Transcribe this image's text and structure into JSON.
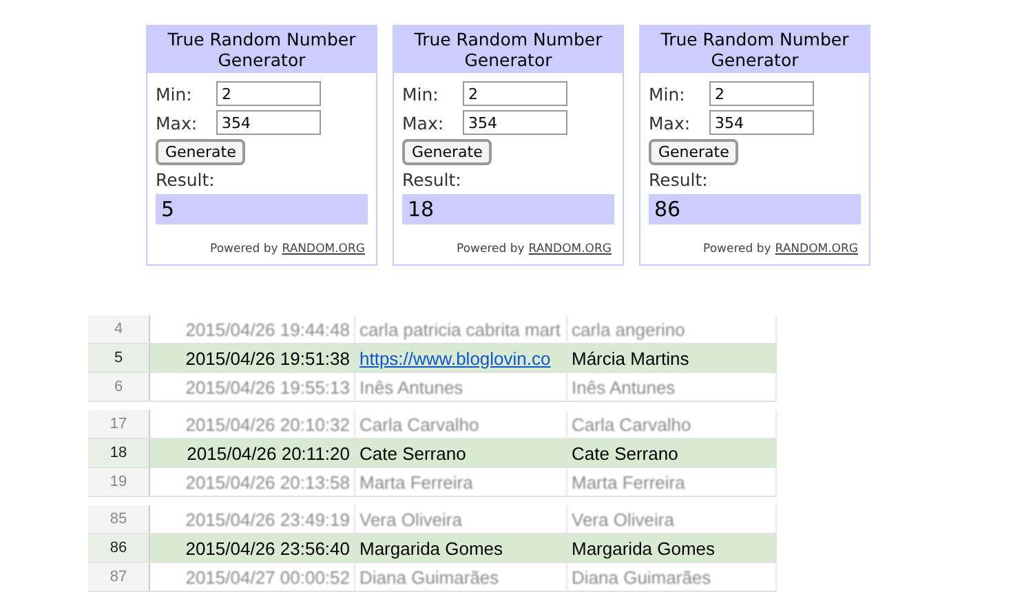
{
  "widgets": [
    {
      "title": "True Random Number Generator",
      "min_label": "Min:",
      "min": "2",
      "max_label": "Max:",
      "max": "354",
      "button": "Generate",
      "result_label": "Result:",
      "result": "5",
      "powered": "Powered by",
      "link": "RANDOM.ORG"
    },
    {
      "title": "True Random Number Generator",
      "min_label": "Min:",
      "min": "2",
      "max_label": "Max:",
      "max": "354",
      "button": "Generate",
      "result_label": "Result:",
      "result": "18",
      "powered": "Powered by",
      "link": "RANDOM.ORG"
    },
    {
      "title": "True Random Number Generator",
      "min_label": "Min:",
      "min": "2",
      "max_label": "Max:",
      "max": "354",
      "button": "Generate",
      "result_label": "Result:",
      "result": "86",
      "powered": "Powered by",
      "link": "RANDOM.ORG"
    }
  ],
  "sheet_excerpts": [
    {
      "rows": [
        {
          "number": "4",
          "selected": false,
          "cells": [
            {
              "text": "2015/04/26 19:44:48"
            },
            {
              "text": "carla patricia cabrita mart"
            },
            {
              "text": "carla angerino"
            }
          ]
        },
        {
          "number": "5",
          "selected": true,
          "cells": [
            {
              "text": "2015/04/26 19:51:38"
            },
            {
              "text": "https://www.bloglovin.co",
              "kind": "link"
            },
            {
              "text": "Márcia Martins"
            }
          ]
        },
        {
          "number": "6",
          "selected": false,
          "cells": [
            {
              "text": "2015/04/26 19:55:13"
            },
            {
              "text": "Inês Antunes"
            },
            {
              "text": "Inês Antunes"
            }
          ]
        }
      ]
    },
    {
      "rows": [
        {
          "number": "17",
          "selected": false,
          "cells": [
            {
              "text": "2015/04/26 20:10:32"
            },
            {
              "text": "Carla Carvalho"
            },
            {
              "text": "Carla Carvalho"
            }
          ]
        },
        {
          "number": "18",
          "selected": true,
          "cells": [
            {
              "text": "2015/04/26 20:11:20"
            },
            {
              "text": "Cate Serrano"
            },
            {
              "text": "Cate Serrano"
            }
          ]
        },
        {
          "number": "19",
          "selected": false,
          "cells": [
            {
              "text": "2015/04/26 20:13:58"
            },
            {
              "text": "Marta Ferreira"
            },
            {
              "text": "Marta Ferreira"
            }
          ]
        }
      ]
    },
    {
      "rows": [
        {
          "number": "85",
          "selected": false,
          "cells": [
            {
              "text": "2015/04/26 23:49:19"
            },
            {
              "text": "Vera Oliveira"
            },
            {
              "text": "Vera Oliveira"
            }
          ]
        },
        {
          "number": "86",
          "selected": true,
          "cells": [
            {
              "text": "2015/04/26 23:56:40"
            },
            {
              "text": "Margarida Gomes"
            },
            {
              "text": "Margarida Gomes"
            }
          ]
        },
        {
          "number": "87",
          "selected": false,
          "cells": [
            {
              "text": "2015/04/27 00:00:52"
            },
            {
              "text": "Diana Guimarães"
            },
            {
              "text": "Diana Guimarães"
            }
          ]
        }
      ]
    }
  ]
}
